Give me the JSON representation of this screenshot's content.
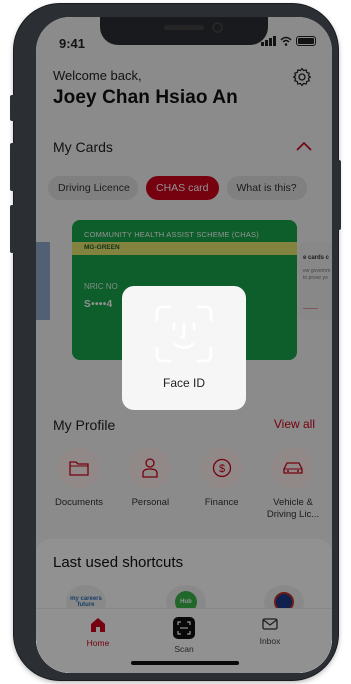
{
  "status": {
    "time": "9:41"
  },
  "header": {
    "welcome": "Welcome back,",
    "user_name": "Joey Chan Hsiao An"
  },
  "cards": {
    "title": "My Cards",
    "tabs": [
      {
        "label": "Driving Licence",
        "active": false
      },
      {
        "label": "CHAS card",
        "active": true
      },
      {
        "label": "What is this?",
        "active": false
      }
    ],
    "chas": {
      "scheme": "COMMUNITY HEALTH ASSIST SCHEME (CHAS)",
      "tier": "MG-GREEN",
      "nric_label": "NRIC NO",
      "nric_value": "S••••4"
    },
    "next_card_peek": {
      "title": "e cards c",
      "subtitle": "ew governm e to prove yo"
    }
  },
  "profile": {
    "title": "My Profile",
    "view_all": "View all",
    "items": [
      {
        "label": "Documents",
        "icon": "folder-icon"
      },
      {
        "label": "Personal",
        "icon": "person-icon"
      },
      {
        "label": "Finance",
        "icon": "dollar-icon"
      },
      {
        "label": "Vehicle & Driving Lic...",
        "icon": "car-icon"
      }
    ]
  },
  "shortcuts": {
    "title": "Last used shortcuts",
    "logos": [
      {
        "text": "my careers future",
        "icon": "mycareersfuture-logo"
      },
      {
        "text": "Hub",
        "icon": "healthhub-logo"
      },
      {
        "text": "",
        "icon": "government-crest-logo"
      }
    ]
  },
  "tabbar": [
    {
      "label": "Home",
      "icon": "home-icon",
      "active": true
    },
    {
      "label": "Scan",
      "icon": "scan-icon",
      "active": false
    },
    {
      "label": "Inbox",
      "icon": "inbox-icon",
      "active": false
    }
  ],
  "faceid": {
    "label": "Face ID"
  },
  "colors": {
    "accent": "#d0021b",
    "chas_green": "#17a64a",
    "chas_band": "#e3e770"
  }
}
